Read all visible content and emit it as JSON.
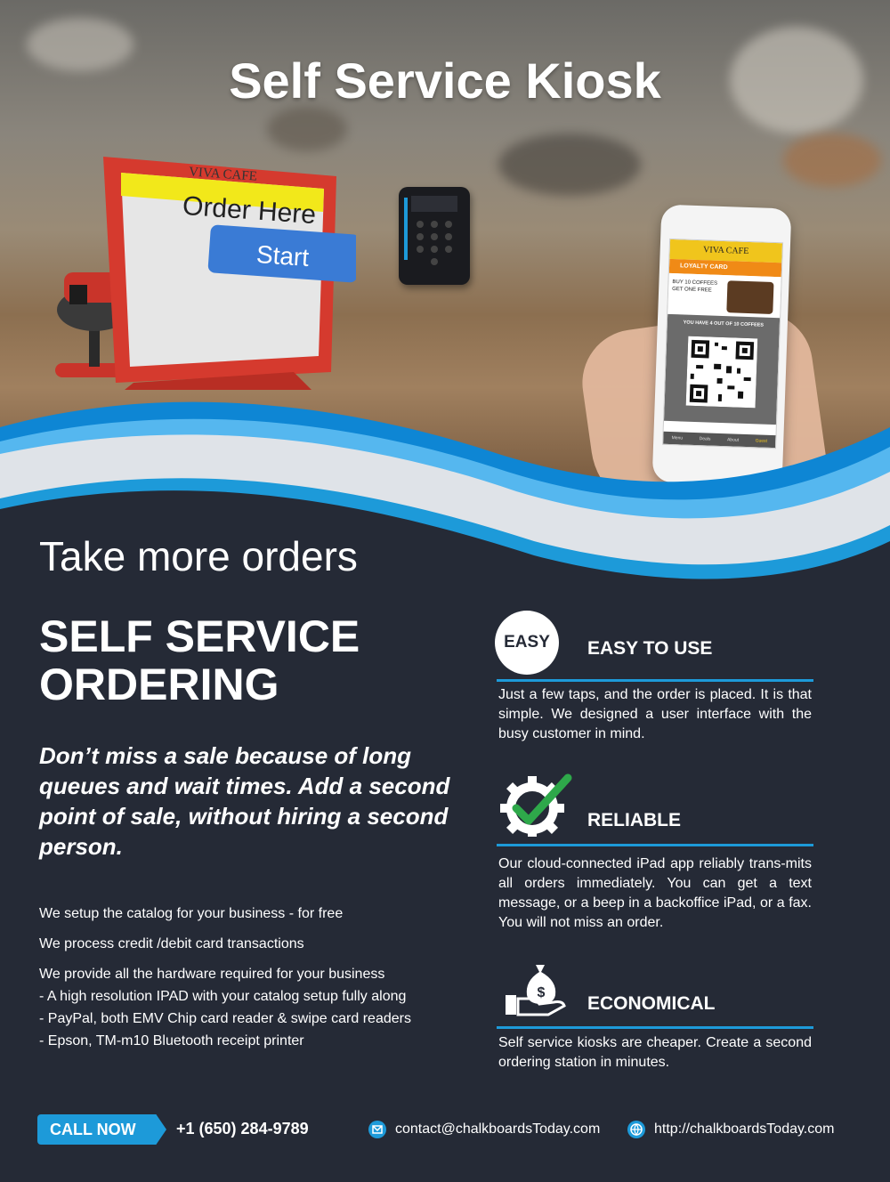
{
  "hero": {
    "title": "Self Service Kiosk",
    "kiosk_brand": "VIVA CAFE",
    "kiosk_order": "Order Here",
    "kiosk_start": "Start",
    "phone_brand": "VIVA CAFE",
    "phone_loyalty": "LOYALTY CARD",
    "phone_offer": "BUY 10 COFFEES GET ONE FREE",
    "phone_progress": "YOU HAVE 4 OUT OF 10 COFFEES",
    "phone_nav": [
      "Menu",
      "Deals",
      "About",
      "Guest"
    ]
  },
  "main": {
    "subtitle": "Take more orders",
    "heading_line1": "SELF SERVICE",
    "heading_line2": "ORDERING",
    "tagline": "Don’t miss a sale because of long queues and wait times. Add a second point of sale, without hiring a second person.",
    "lines": [
      "We setup the catalog for your business  - for free",
      "We process credit /debit card transactions",
      "We provide all the hardware required for your business",
      "- A high resolution IPAD with your catalog setup fully along",
      "- PayPal, both EMV Chip card reader & swipe card readers",
      "- Epson, TM-m10 Bluetooth receipt printer"
    ]
  },
  "features": [
    {
      "icon": "easy-badge-icon",
      "badge": "EASY",
      "title": "EASY TO USE",
      "text": "Just a few taps, and the order is placed. It is that simple. We designed a user interface with the busy customer in mind."
    },
    {
      "icon": "gear-check-icon",
      "title": "RELIABLE",
      "text": "Our cloud-connected iPad app reliably trans-mits all orders immediately. You can get a text message, or a beep in a backoffice iPad, or a fax. You will not miss an order."
    },
    {
      "icon": "money-bag-hand-icon",
      "title": "ECONOMICAL",
      "text": "Self service kiosks are cheaper. Create a second ordering station in minutes."
    }
  ],
  "footer": {
    "call_label": "CALL NOW",
    "phone": "+1 (650) 284-9789",
    "email": "contact@chalkboardsToday.com",
    "website": "http://chalkboardsToday.com"
  },
  "colors": {
    "accent": "#1d9ad9",
    "background": "#252a36",
    "kiosk_red": "#d53a2e",
    "kiosk_yellow": "#f2e81a"
  }
}
